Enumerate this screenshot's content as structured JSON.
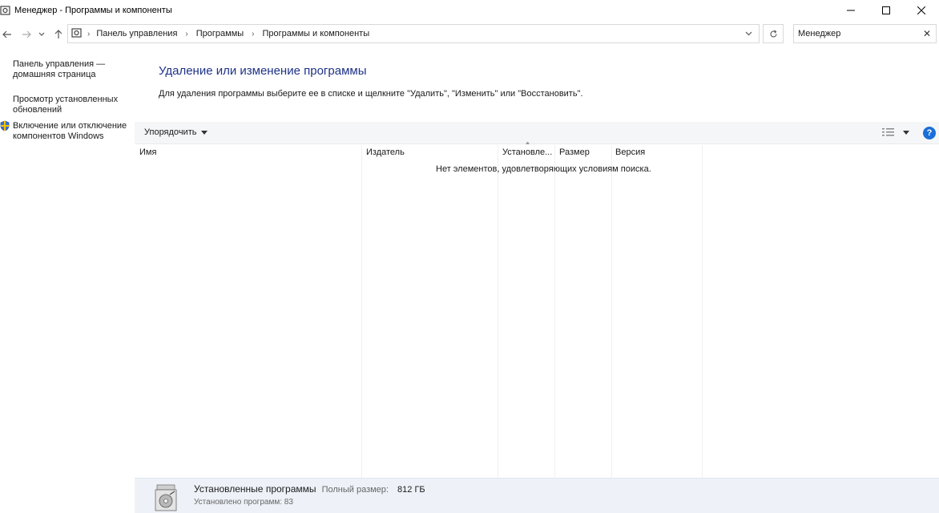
{
  "window": {
    "title": "Менеджер - Программы и компоненты"
  },
  "breadcrumb": [
    "Панель управления",
    "Программы",
    "Программы и компоненты"
  ],
  "search": {
    "value": "Менеджер"
  },
  "leftnav": {
    "home_line1": "Панель управления —",
    "home_line2": "домашняя страница",
    "updates_line1": "Просмотр установленных",
    "updates_line2": "обновлений",
    "features_line1": "Включение или отключение",
    "features_line2": "компонентов Windows"
  },
  "main": {
    "heading": "Удаление или изменение программы",
    "instruction": "Для удаления программы выберите ее в списке и щелкните \"Удалить\", \"Изменить\" или \"Восстановить\"."
  },
  "toolbar": {
    "organize_label": "Упорядочить"
  },
  "columns": [
    "Имя",
    "Издатель",
    "Установле...",
    "Размер",
    "Версия"
  ],
  "empty_message": "Нет элементов, удовлетворяющих условиям поиска.",
  "status": {
    "title": "Установленные программы",
    "total_size_label": "Полный размер:",
    "total_size_value": "812 ГБ",
    "installed_count": "Установлено программ: 83"
  },
  "colors": {
    "heading": "#1e3287",
    "help_icon": "#1a6ed8",
    "status_bg": "#eef2f8"
  }
}
